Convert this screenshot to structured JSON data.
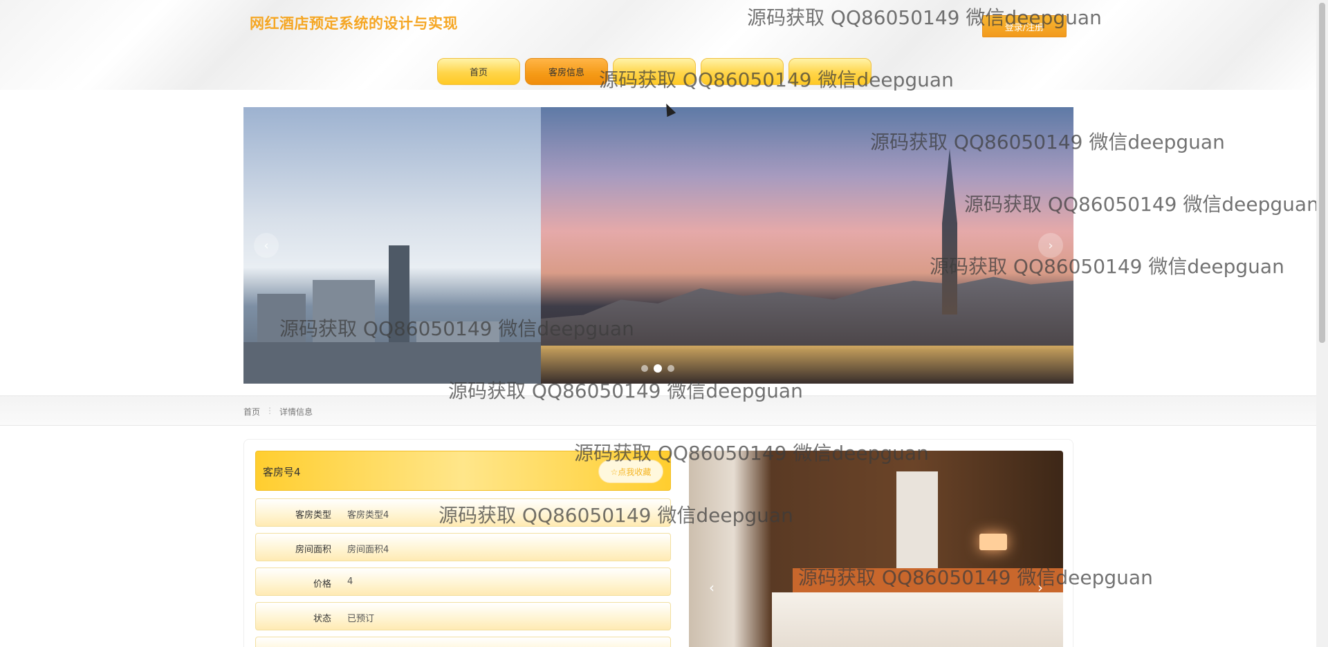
{
  "header": {
    "title": "网红酒店预定系统的设计与实现",
    "login_label": "登录/注册"
  },
  "nav": {
    "items": [
      {
        "label": "首页",
        "active": false
      },
      {
        "label": "客房信息",
        "active": true
      },
      {
        "label": "",
        "active": false
      },
      {
        "label": "",
        "active": false
      },
      {
        "label": "",
        "active": false
      }
    ]
  },
  "banner": {
    "prev_icon": "‹",
    "next_icon": "›",
    "active_dot": 2,
    "dot_count": 3
  },
  "breadcrumb": {
    "home": "首页",
    "separator": "⋮",
    "current": "详情信息"
  },
  "detail": {
    "title": "客房号4",
    "favorite_label": "☆点我收藏",
    "fields": [
      {
        "label": "客房类型",
        "value": "客房类型4"
      },
      {
        "label": "房间面积",
        "value": "房间面积4"
      },
      {
        "label": "价格",
        "value": "4"
      },
      {
        "label": "状态",
        "value": "已预订"
      }
    ],
    "photo_prev_icon": "‹",
    "photo_next_icon": "›"
  },
  "watermark": "源码获取 QQ86050149 微信deepguan",
  "colors": {
    "title": "#f5a623",
    "accent": "#ffc925",
    "active_nav": "#f59a16"
  }
}
